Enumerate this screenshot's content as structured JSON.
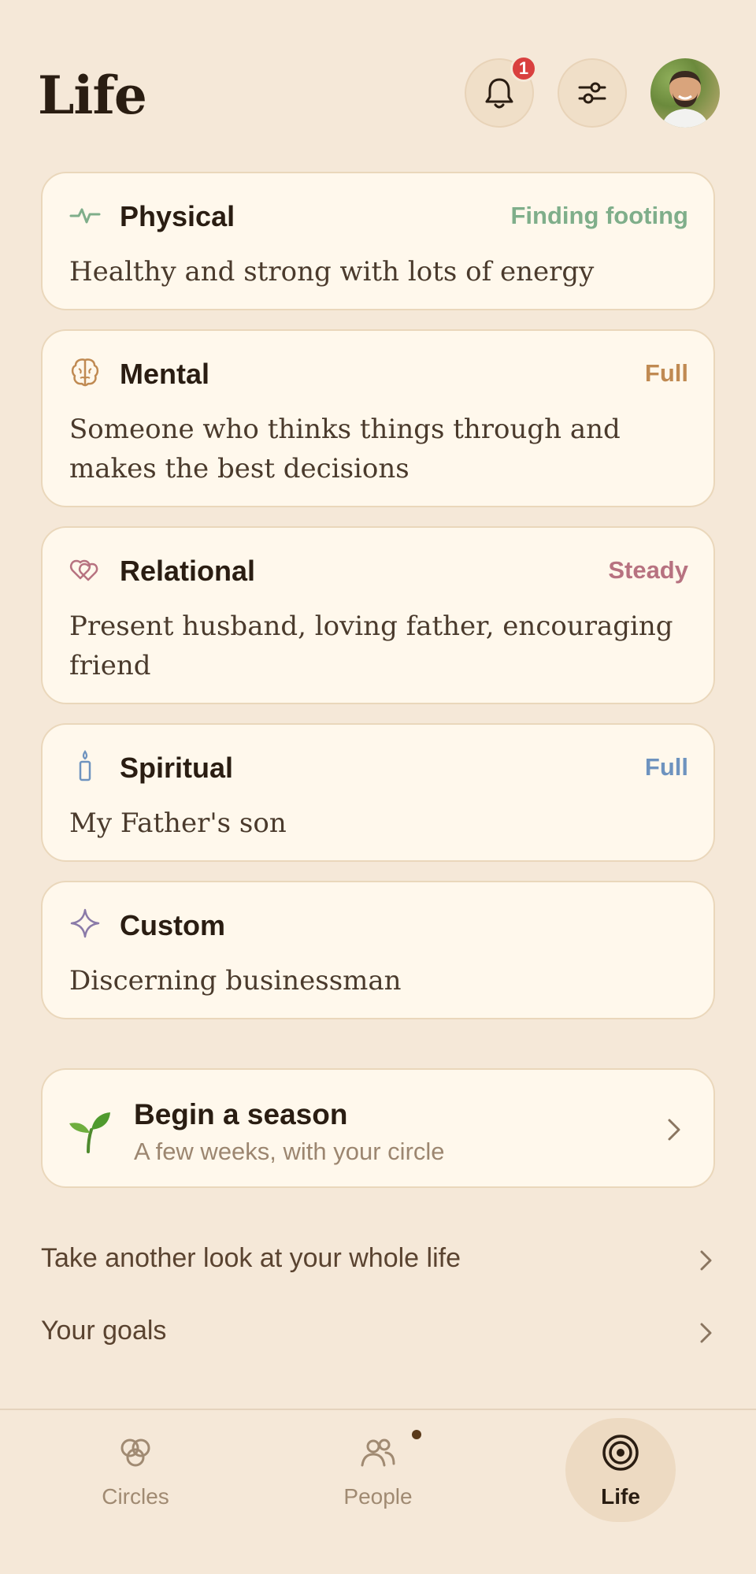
{
  "header": {
    "title": "Life",
    "notification_count": "1"
  },
  "areas": [
    {
      "title": "Physical",
      "status": "Finding footing",
      "status_color": "#7fae8a",
      "description": "Healthy and strong with lots of energy",
      "icon": "pulse-icon"
    },
    {
      "title": "Mental",
      "status": "Full",
      "status_color": "#c08a52",
      "description": "Someone who thinks things through and makes the best decisions",
      "icon": "brain-icon"
    },
    {
      "title": "Relational",
      "status": "Steady",
      "status_color": "#b77280",
      "description": "Present husband, loving father, encouraging friend",
      "icon": "hearts-icon"
    },
    {
      "title": "Spiritual",
      "status": "Full",
      "status_color": "#6e93bf",
      "description": "My Father's son",
      "icon": "candle-icon"
    },
    {
      "title": "Custom",
      "status": "",
      "status_color": "#8a7aa8",
      "description": "Discerning businessman",
      "icon": "sparkle-icon"
    }
  ],
  "season": {
    "title": "Begin a season",
    "subtitle": "A few weeks, with your circle"
  },
  "links": [
    {
      "label": "Take another look at your whole life"
    },
    {
      "label": "Your goals"
    }
  ],
  "nav": [
    {
      "label": "Circles"
    },
    {
      "label": "People"
    },
    {
      "label": "Life"
    }
  ]
}
